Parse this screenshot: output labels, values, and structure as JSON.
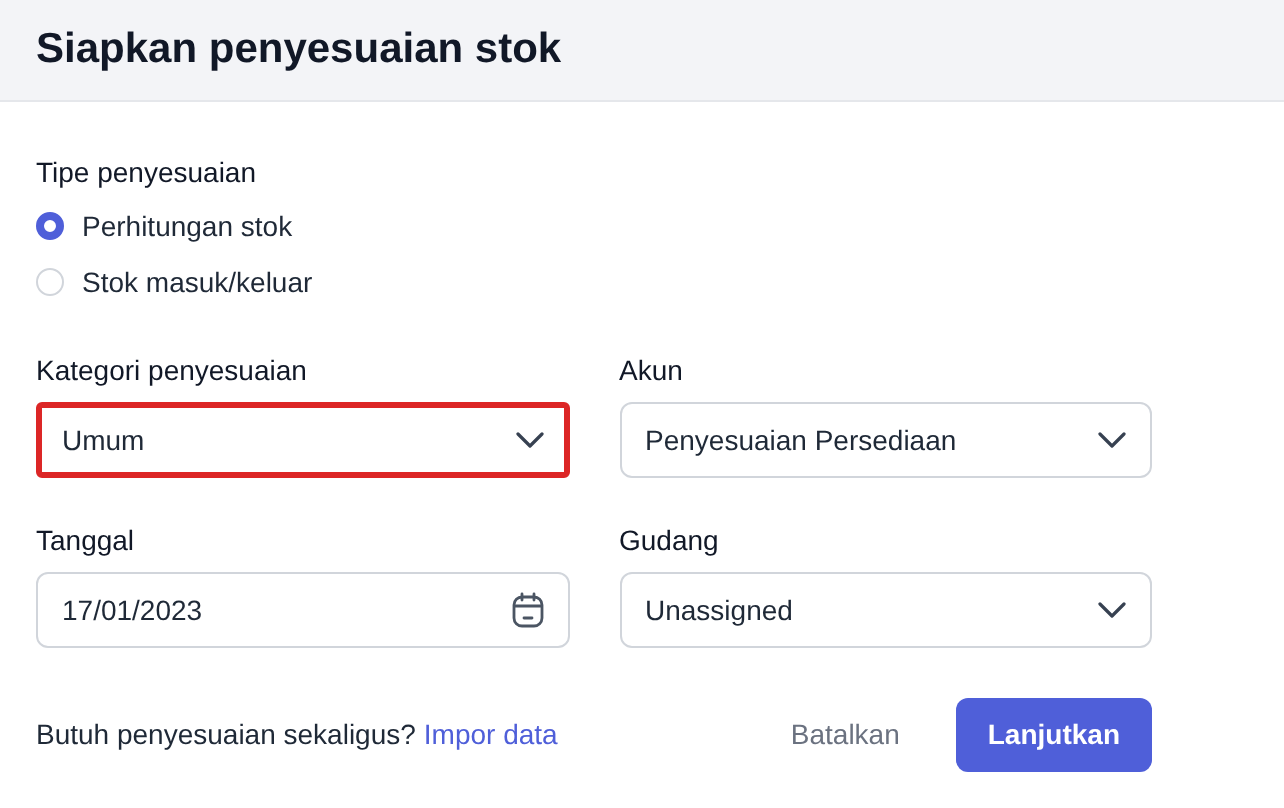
{
  "header": {
    "title": "Siapkan penyesuaian stok"
  },
  "adjustment_type": {
    "label": "Tipe penyesuaian",
    "options": [
      {
        "label": "Perhitungan stok",
        "selected": true
      },
      {
        "label": "Stok masuk/keluar",
        "selected": false
      }
    ]
  },
  "fields": [
    {
      "kind": "select",
      "label": "Kategori penyesuaian",
      "value": "Umum",
      "highlighted": true
    },
    {
      "kind": "select",
      "label": "Akun",
      "value": "Penyesuaian Persediaan",
      "highlighted": false
    },
    {
      "kind": "date",
      "label": "Tanggal",
      "value": "17/01/2023",
      "highlighted": false
    },
    {
      "kind": "select",
      "label": "Gudang",
      "value": "Unassigned",
      "highlighted": false
    }
  ],
  "footer": {
    "prompt": "Butuh penyesuaian sekaligus?",
    "link": "Impor data",
    "cancel": "Batalkan",
    "submit": "Lanjutkan"
  }
}
